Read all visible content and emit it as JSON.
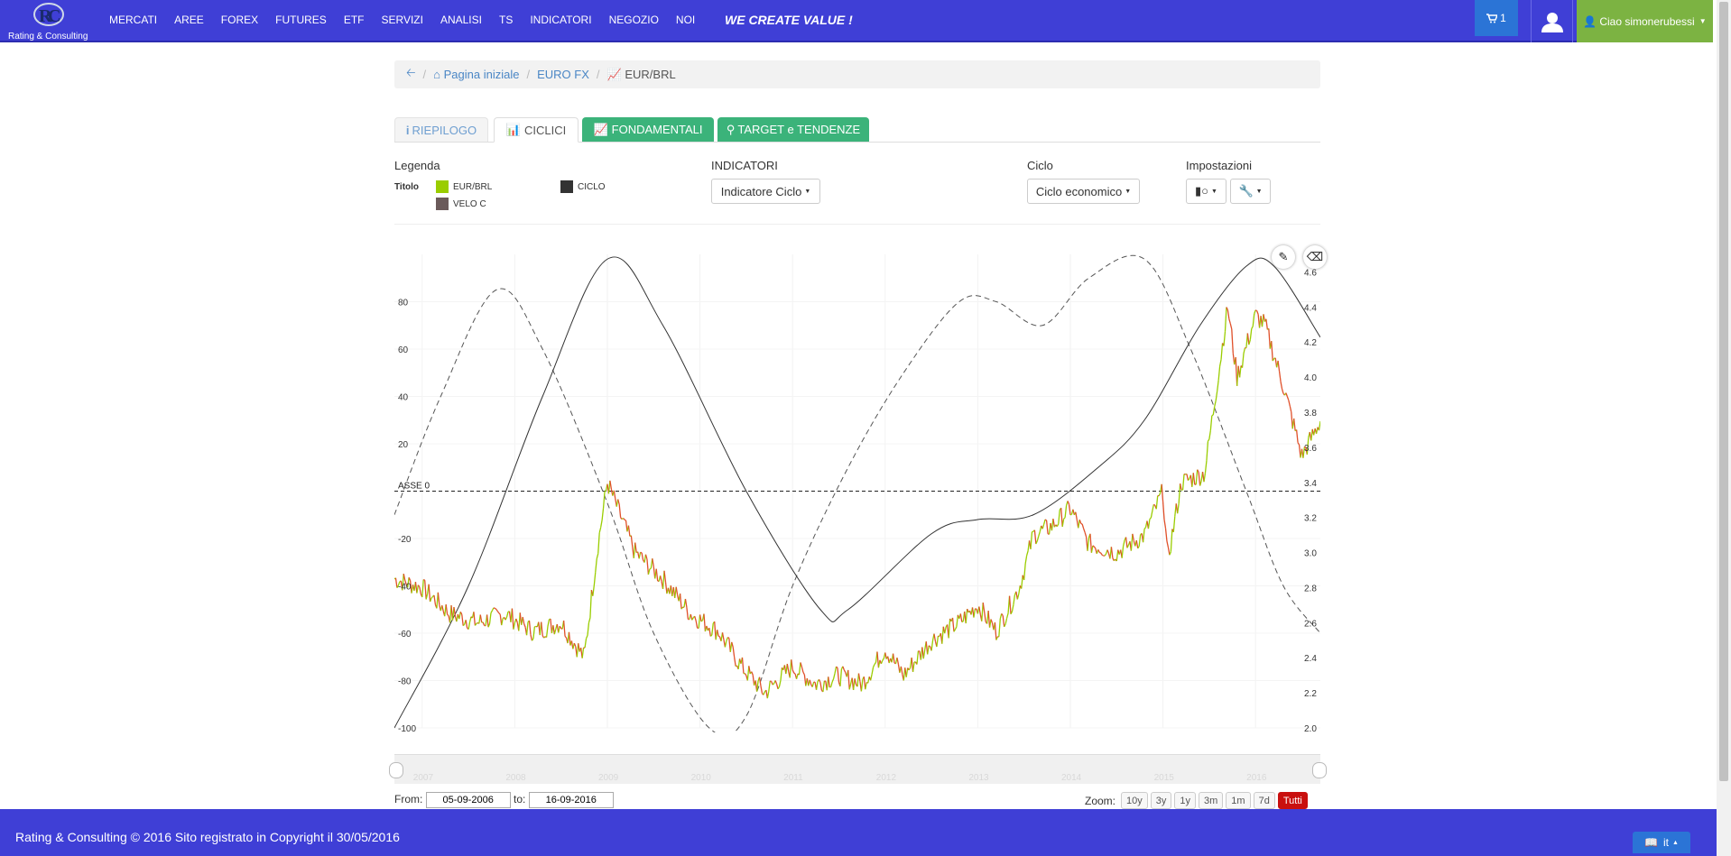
{
  "brand": {
    "tagline": "Rating & Consulting"
  },
  "nav": {
    "menu": [
      "MERCATI",
      "AREE",
      "FOREX",
      "FUTURES",
      "ETF",
      "SERVIZI",
      "ANALISI",
      "TS",
      "INDICATORI",
      "NEGOZIO",
      "NOI"
    ],
    "slogan": "WE CREATE VALUE !",
    "cart_count": "1",
    "greeting": "Ciao",
    "username": "simonerubessi"
  },
  "breadcrumb": {
    "home": "Pagina iniziale",
    "section": "EURO FX",
    "current": "EUR/BRL"
  },
  "tabs": [
    "RIEPILOGO",
    "CICLICI",
    "FONDAMENTALI",
    "TARGET e TENDENZE"
  ],
  "controls": {
    "legend_title": "Legenda",
    "titolo_label": "Titolo",
    "legend": [
      {
        "name": "EUR/BRL",
        "color": "#9acd00"
      },
      {
        "name": "CICLO",
        "color": "#333333"
      },
      {
        "name": "VELO C",
        "color": "#6b5a5a"
      }
    ],
    "indicatori_label": "INDICATORI",
    "indicatori_value": "Indicatore Ciclo",
    "ciclo_label": "Ciclo",
    "ciclo_value": "Ciclo economico",
    "impostazioni_label": "Impostazioni"
  },
  "chart_data": {
    "type": "line",
    "title": "",
    "xlabel": "",
    "ylabel": "",
    "x_ticks": [
      "2007",
      "2008",
      "2009",
      "2010",
      "2011",
      "2012",
      "2013",
      "2014",
      "2015",
      "2016"
    ],
    "y_left_ticks": [
      80,
      60,
      40,
      20,
      -20,
      -40,
      -60,
      -80,
      -100
    ],
    "y_left_range": [
      -100,
      100
    ],
    "y_right_ticks": [
      "4.6",
      "4.4",
      "4.2",
      "4.0",
      "3.8",
      "3.6",
      "3.4",
      "3.2",
      "3.0",
      "2.8",
      "2.6",
      "2.4",
      "2.2",
      "2.0"
    ],
    "y_right_range": [
      2.0,
      4.7
    ],
    "zero_line_label": "ASSE 0",
    "series": [
      {
        "name": "EUR/BRL",
        "axis": "right",
        "x": [
          2006.7,
          2007.0,
          2007.3,
          2007.6,
          2007.9,
          2008.2,
          2008.5,
          2008.75,
          2008.9,
          2009.0,
          2009.3,
          2009.6,
          2009.9,
          2010.2,
          2010.45,
          2010.7,
          2011.0,
          2011.25,
          2011.5,
          2011.75,
          2012.0,
          2012.2,
          2012.5,
          2012.8,
          2013.0,
          2013.2,
          2013.45,
          2013.6,
          2013.8,
          2014.0,
          2014.2,
          2014.5,
          2014.8,
          2015.0,
          2015.05,
          2015.2,
          2015.45,
          2015.7,
          2015.8,
          2016.0,
          2016.1,
          2016.3,
          2016.5,
          2016.7
        ],
        "y": [
          2.85,
          2.8,
          2.65,
          2.6,
          2.65,
          2.55,
          2.6,
          2.4,
          3.05,
          3.4,
          3.0,
          2.85,
          2.65,
          2.55,
          2.35,
          2.2,
          2.35,
          2.25,
          2.3,
          2.25,
          2.45,
          2.3,
          2.5,
          2.6,
          2.7,
          2.55,
          2.8,
          3.1,
          3.15,
          3.25,
          3.05,
          3.0,
          3.1,
          3.35,
          2.95,
          3.4,
          3.45,
          4.4,
          4.0,
          4.35,
          4.3,
          3.95,
          3.55,
          3.75
        ]
      },
      {
        "name": "CICLO",
        "axis": "left",
        "x": [
          2006.7,
          2007.5,
          2008.3,
          2009.0,
          2009.6,
          2010.5,
          2011.3,
          2011.6,
          2012.5,
          2013.0,
          2013.6,
          2014.3,
          2014.8,
          2015.4,
          2015.9,
          2016.2,
          2016.7
        ],
        "y": [
          -100,
          -40,
          40,
          98,
          70,
          0,
          -50,
          -50,
          -18,
          -12,
          -10,
          10,
          30,
          70,
          95,
          95,
          65
        ]
      },
      {
        "name": "VELO C",
        "axis": "left",
        "x": [
          2006.7,
          2007.2,
          2007.8,
          2008.3,
          2009.0,
          2009.5,
          2010.1,
          2010.5,
          2011.0,
          2011.6,
          2012.2,
          2012.8,
          2013.2,
          2013.7,
          2014.2,
          2014.8,
          2015.3,
          2015.9,
          2016.3,
          2016.7
        ],
        "y": [
          -10,
          40,
          85,
          60,
          -5,
          -60,
          -100,
          -95,
          -40,
          10,
          50,
          80,
          80,
          70,
          90,
          98,
          60,
          0,
          -40,
          -60
        ]
      }
    ]
  },
  "range": {
    "from_label": "From:",
    "from": "05-09-2006",
    "to_label": "to:",
    "to": "16-09-2016"
  },
  "zoom": {
    "label": "Zoom:",
    "buttons": [
      "10y",
      "3y",
      "1y",
      "3m",
      "1m",
      "7d",
      "Tutti"
    ],
    "active": "Tutti"
  },
  "footer": {
    "text": "Rating & Consulting © 2016 Sito registrato in Copyright il 30/05/2016",
    "language": "it"
  }
}
